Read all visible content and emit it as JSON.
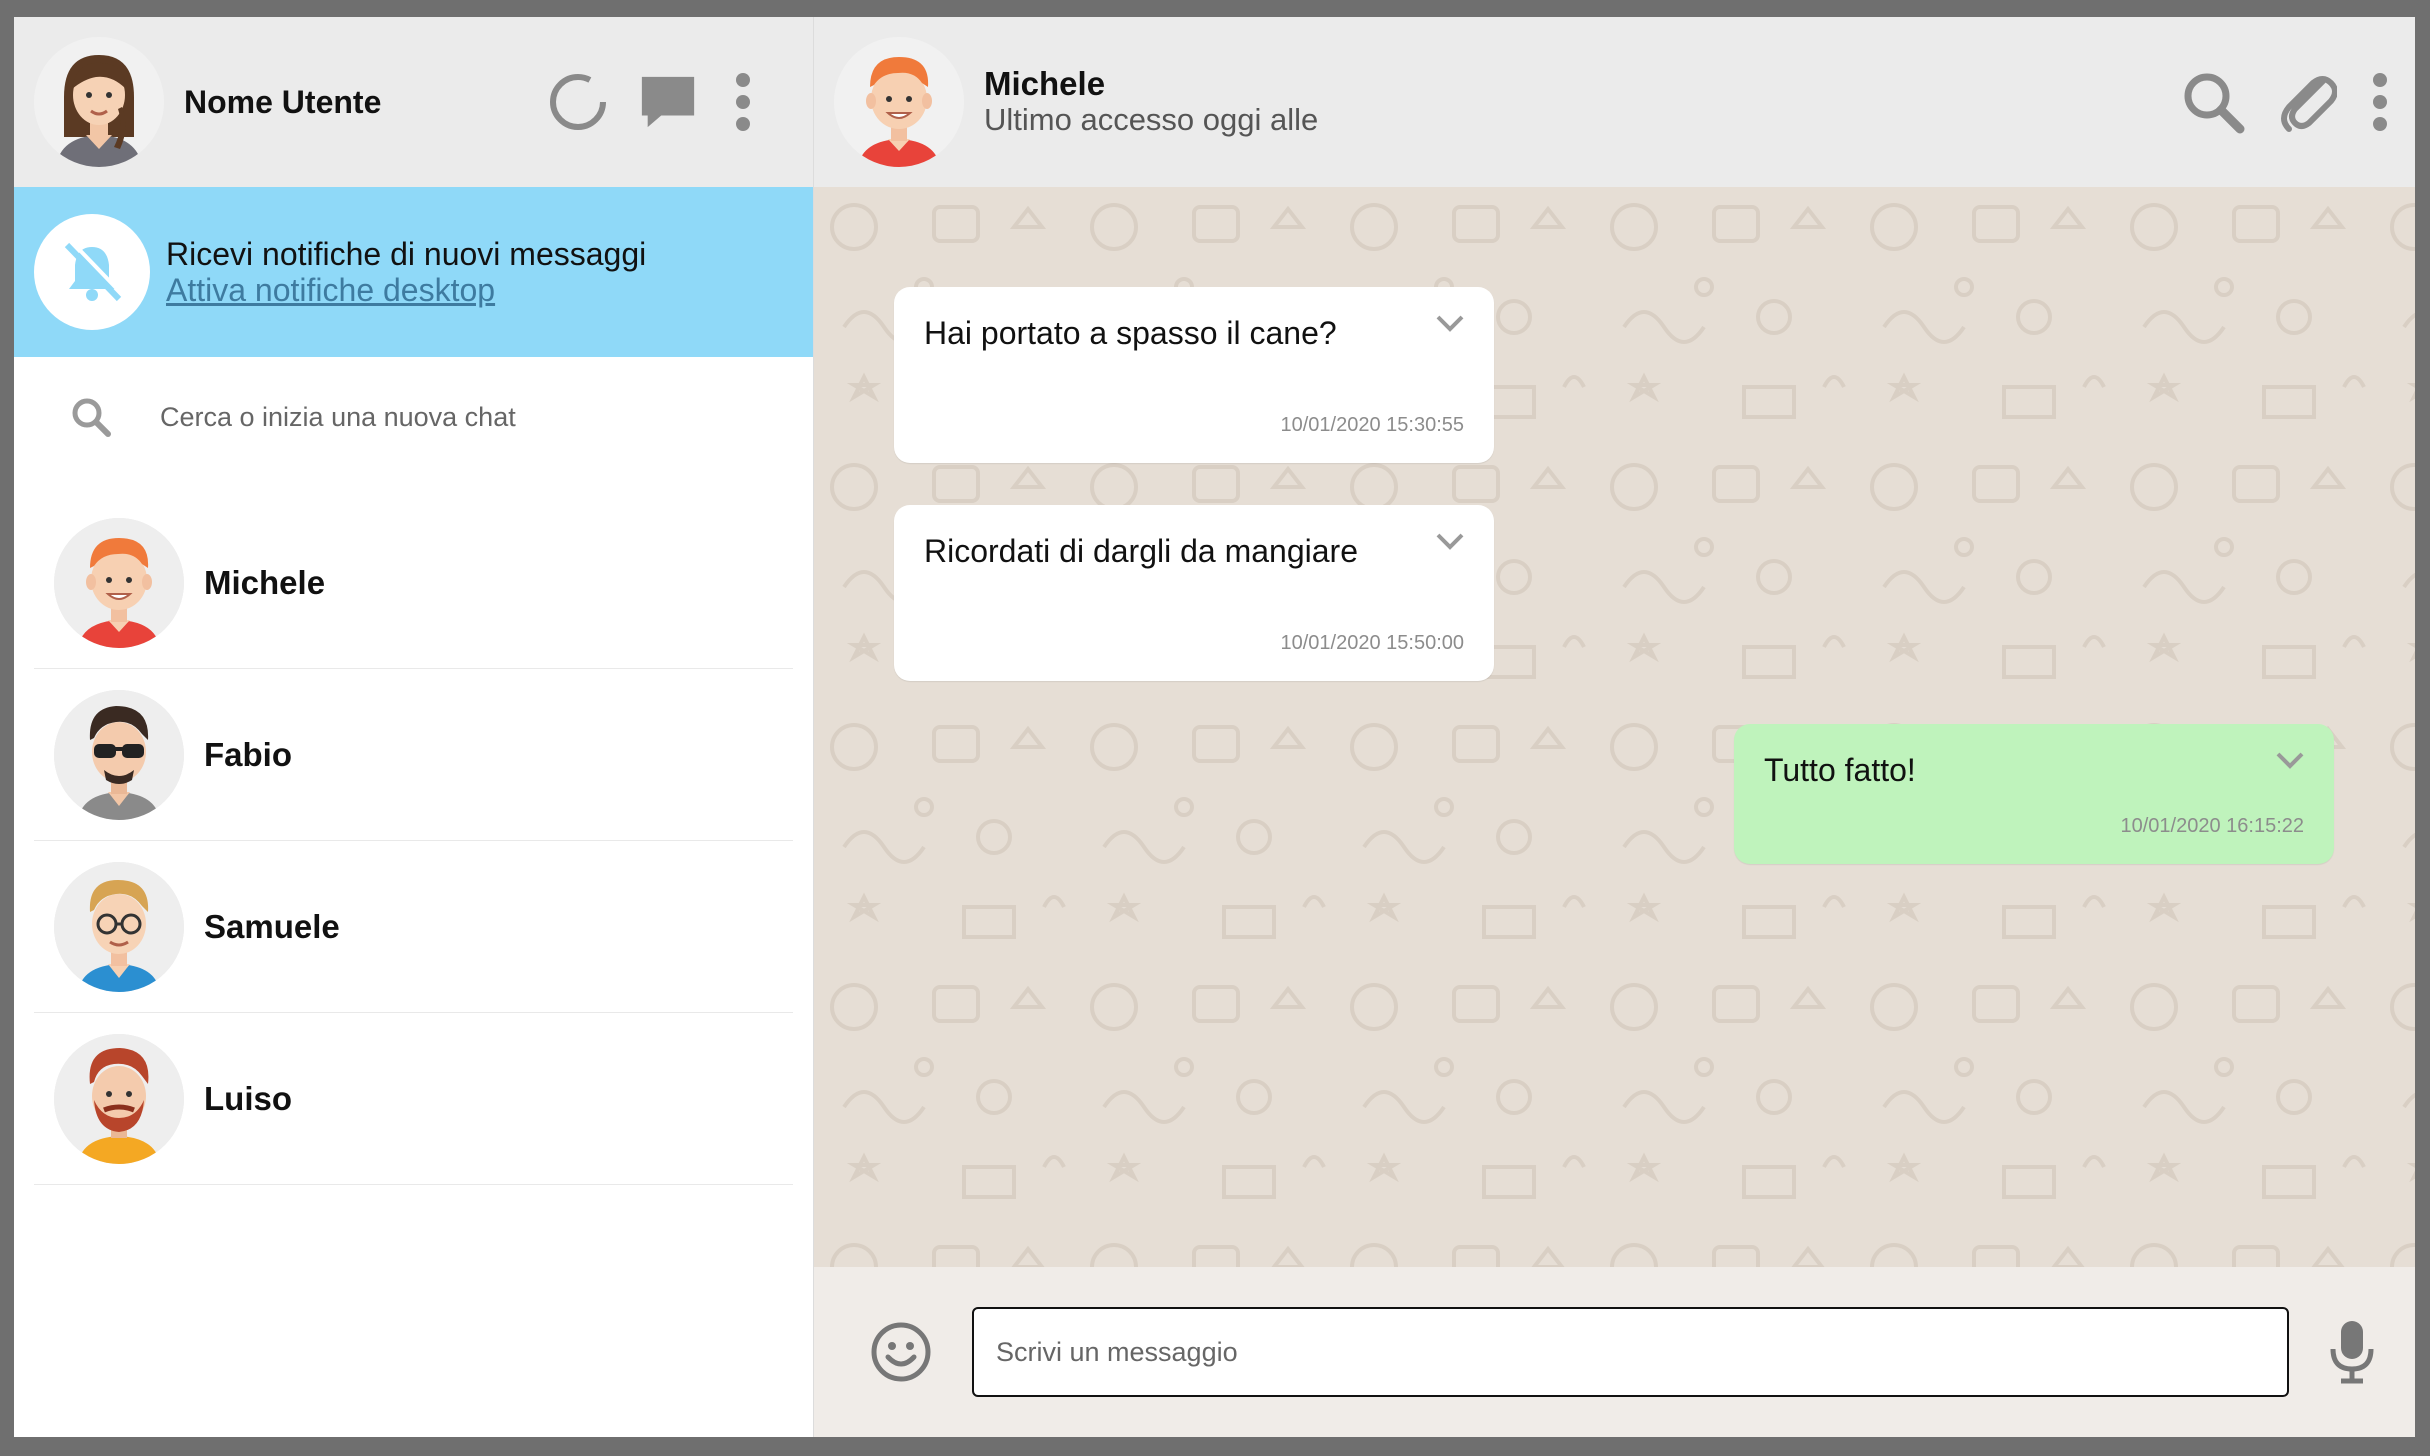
{
  "user": {
    "name": "Nome Utente"
  },
  "header_icons": [
    "status-icon",
    "chat-icon",
    "menu-icon"
  ],
  "notification": {
    "title": "Ricevi notifiche di nuovi messaggi",
    "link": "Attiva notifiche desktop"
  },
  "search": {
    "placeholder": "Cerca o inizia una nuova chat"
  },
  "contacts": [
    {
      "name": "Michele"
    },
    {
      "name": "Fabio"
    },
    {
      "name": "Samuele"
    },
    {
      "name": "Luiso"
    }
  ],
  "chat": {
    "name": "Michele",
    "status": "Ultimo accesso oggi alle",
    "messages": [
      {
        "text": "Hai portato a spasso il cane?",
        "time": "10/01/2020 15:30:55",
        "direction": "received"
      },
      {
        "text": "Ricordati di dargli da mangiare",
        "time": "10/01/2020 15:50:00",
        "direction": "received"
      },
      {
        "text": "Tutto fatto!",
        "time": "10/01/2020 16:15:22",
        "direction": "sent"
      }
    ]
  },
  "composer": {
    "placeholder": "Scrivi un messaggio"
  },
  "colors": {
    "notification_bg": "#8fd9f8",
    "sent_bubble": "#bff3bc",
    "received_bubble": "#ffffff",
    "chat_bg": "#e6ded5",
    "header_bg": "#ebebeb"
  }
}
